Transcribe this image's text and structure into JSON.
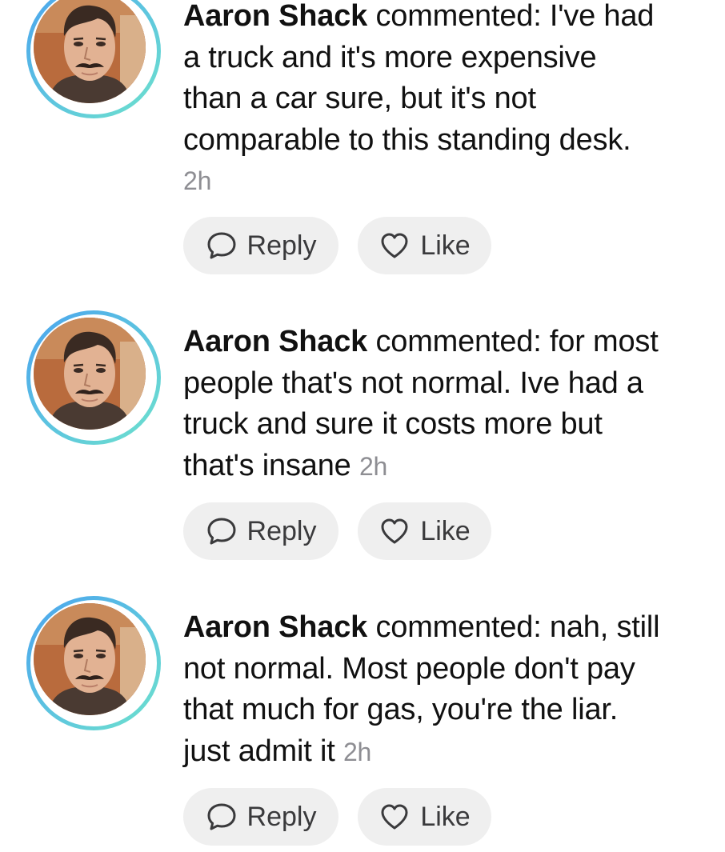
{
  "comments": [
    {
      "author": "Aaron Shack",
      "verb": " commented: ",
      "text_lines": [
        "I've had",
        "a truck and it's more expensive",
        "than a car sure, but it's not",
        "comparable to this standing desk."
      ],
      "time": "2h",
      "reply_label": "Reply",
      "like_label": "Like"
    },
    {
      "author": "Aaron Shack",
      "verb": " commented: ",
      "text_lines": [
        "for most",
        "people that's not normal. Ive had a",
        "truck and sure it costs more but",
        "that's insane"
      ],
      "time": "2h",
      "reply_label": "Reply",
      "like_label": "Like"
    },
    {
      "author": "Aaron Shack",
      "verb": " commented: ",
      "text_lines": [
        "nah, still",
        "not normal. Most people don't pay",
        "that much for gas, you're the liar.",
        "just admit it"
      ],
      "time": "2h",
      "reply_label": "Reply",
      "like_label": "Like"
    }
  ],
  "icons": {
    "reply": "speech-bubble-icon",
    "like": "heart-outline-icon"
  },
  "colors": {
    "avatar_ring_start": "#4aa3ee",
    "avatar_ring_end": "#6ee2cc",
    "timestamp": "#8e8e93",
    "button_bg": "#efefef"
  }
}
